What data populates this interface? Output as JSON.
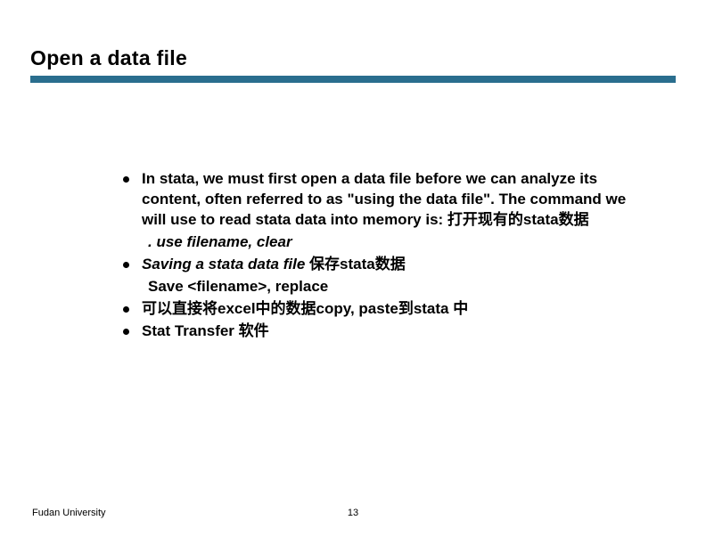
{
  "title": "Open a data file",
  "bullets": [
    {
      "text": "In stata, we must first open a data file before we can analyze its content, often referred to as \"using the data file\". The command we will use to read stata data into memory is: 打开现有的stata数据",
      "sub": ". use filename, clear",
      "sub_italic": false
    },
    {
      "text_prefix": "Saving a stata data file ",
      "text_suffix": "保存stata数据",
      "italic_prefix": true,
      "sub": "Save <filename>, replace",
      "sub_italic": false
    },
    {
      "text": "可以直接将excel中的数据copy, paste到stata 中"
    },
    {
      "text": "Stat Transfer 软件"
    }
  ],
  "footer": {
    "org": "Fudan University",
    "page": "13"
  }
}
